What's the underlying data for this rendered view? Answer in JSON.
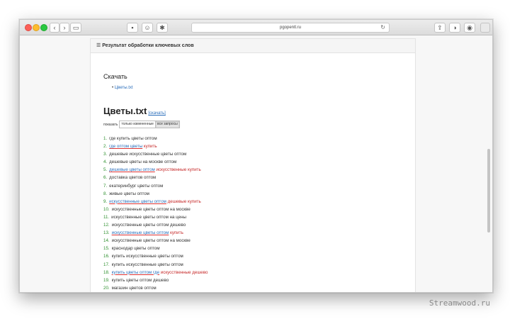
{
  "browser": {
    "url": "pgopentl.ru",
    "reload_icon": "reload-icon",
    "back_icon": "chevron-left-icon",
    "forward_icon": "chevron-right-icon",
    "sidebar_icon": "sidebar-icon",
    "share_icon": "share-icon",
    "tabs_icon": "tabs-icon",
    "extension_icon": "extension-icon"
  },
  "panel": {
    "title": "Результат обработки ключевых слов"
  },
  "download": {
    "title": "Скачать",
    "file_link": "Цветы.txt"
  },
  "file": {
    "title": "Цветы.txt",
    "download_link": "[скачать]"
  },
  "filters": {
    "label": "показать",
    "only_changed": "только измененные",
    "all": "все запросы"
  },
  "keywords": [
    {
      "num": "1.",
      "text": "где купить цветы оптом",
      "mark": ""
    },
    {
      "num": "2.",
      "text": "где оптом цветы",
      "mark": "купить"
    },
    {
      "num": "3.",
      "text": "дешевые искусственные цветы оптом",
      "mark": ""
    },
    {
      "num": "4.",
      "text": "дешевые цветы на москве оптом",
      "mark": ""
    },
    {
      "num": "5.",
      "text": "дешевые цветы оптом",
      "mark": "искусственные купить"
    },
    {
      "num": "6.",
      "text": "доставка цветов оптом",
      "mark": ""
    },
    {
      "num": "7.",
      "text": "екатеринбург цветы оптом",
      "mark": ""
    },
    {
      "num": "8.",
      "text": "живые цветы оптом",
      "mark": ""
    },
    {
      "num": "9.",
      "text": "искусственные цветы оптом",
      "mark": "дешевые купить"
    },
    {
      "num": "10.",
      "text": "искусственные цветы оптом на москве",
      "mark": ""
    },
    {
      "num": "11.",
      "text": "искусственные цветы оптом на цены",
      "mark": ""
    },
    {
      "num": "12.",
      "text": "искусственные цветы оптом дешево",
      "mark": ""
    },
    {
      "num": "13.",
      "text": "искусственные цветы оптом",
      "mark": "купить"
    },
    {
      "num": "14.",
      "text": "искусственные цветы оптом на москве",
      "mark": ""
    },
    {
      "num": "15.",
      "text": "краснодар цветы оптом",
      "mark": ""
    },
    {
      "num": "16.",
      "text": "купить искусственные цветы оптом",
      "mark": ""
    },
    {
      "num": "17.",
      "text": "купить искусственные цветы оптом",
      "mark": ""
    },
    {
      "num": "18.",
      "text": "купить цветы оптом где",
      "mark": "искусственные дешево"
    },
    {
      "num": "19.",
      "text": "купить цветы оптом дешево",
      "mark": ""
    },
    {
      "num": "20.",
      "text": "магазин цветов оптом",
      "mark": ""
    }
  ],
  "watermark": "Streamwood.ru"
}
